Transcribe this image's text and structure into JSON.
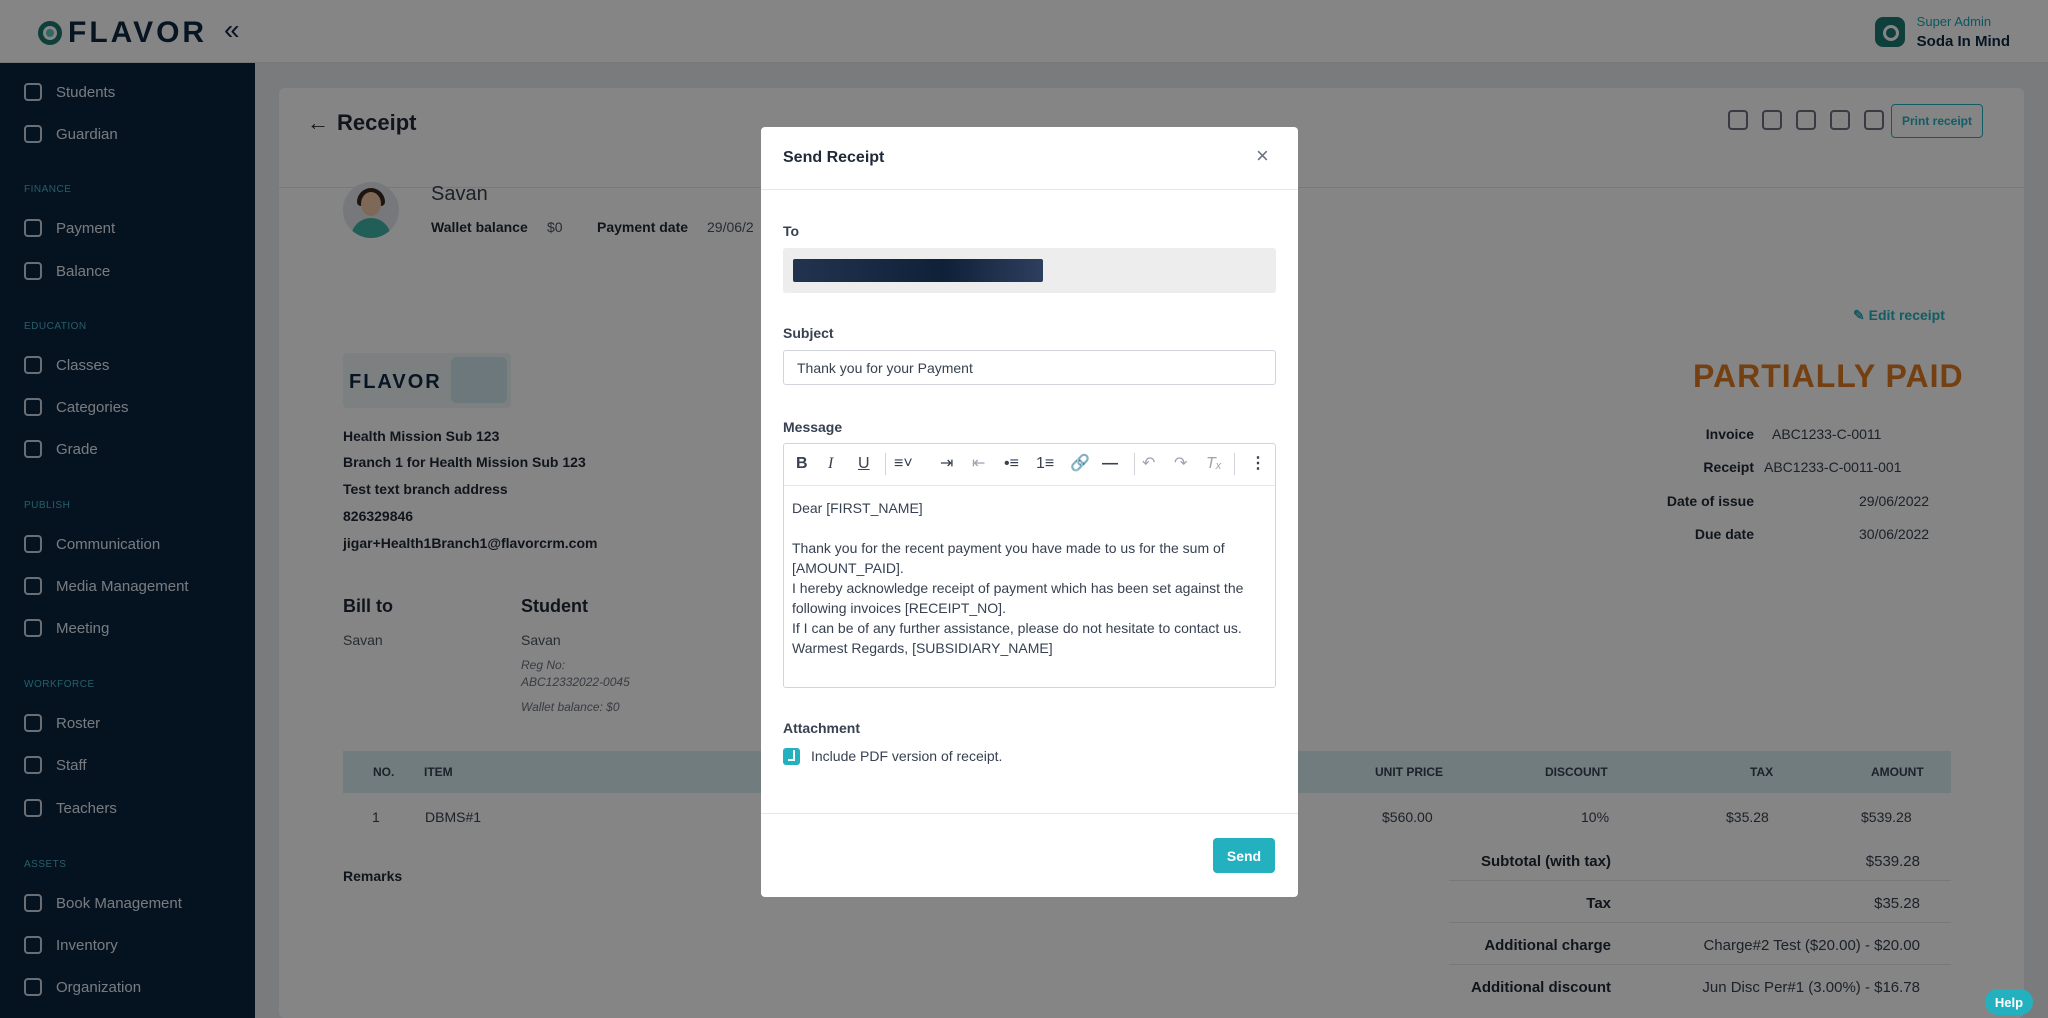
{
  "app": {
    "logo_text": "FLAVOR",
    "collapse_icon": "«"
  },
  "user": {
    "role": "Super Admin",
    "name": "Soda In Mind"
  },
  "sidebar": {
    "items": [
      {
        "label": "Students"
      },
      {
        "label": "Guardian"
      },
      {
        "section": "FINANCE"
      },
      {
        "label": "Payment"
      },
      {
        "label": "Balance"
      },
      {
        "section": "EDUCATION"
      },
      {
        "label": "Classes"
      },
      {
        "label": "Categories"
      },
      {
        "label": "Grade"
      },
      {
        "section": "PUBLISH"
      },
      {
        "label": "Communication"
      },
      {
        "label": "Media Management"
      },
      {
        "label": "Meeting"
      },
      {
        "section": "WORKFORCE"
      },
      {
        "label": "Roster"
      },
      {
        "label": "Staff"
      },
      {
        "label": "Teachers"
      },
      {
        "section": "ASSETS"
      },
      {
        "label": "Book Management"
      },
      {
        "label": "Inventory"
      },
      {
        "label": "Organization"
      }
    ]
  },
  "page": {
    "title": "Receipt",
    "print_label": "Print receipt",
    "edit_label": "Edit receipt",
    "status": "PARTIALLY PAID"
  },
  "student": {
    "name": "Savan",
    "wallet_label": "Wallet balance",
    "wallet_value": "$0",
    "payment_date_label": "Payment date",
    "payment_date_value": "29/06/2"
  },
  "receipt_info": {
    "invoice_label": "Invoice",
    "invoice_value": "ABC1233-C-0011",
    "receipt_label": "Receipt",
    "receipt_value": "ABC1233-C-0011-001",
    "issue_label": "Date of issue",
    "issue_value": "29/06/2022",
    "due_label": "Due date",
    "due_value": "30/06/2022"
  },
  "organization": {
    "logo_text": "FLAVOR",
    "lines": [
      "Health Mission Sub 123",
      "Branch 1 for Health Mission Sub 123",
      "Test text branch address",
      "826329846",
      "jigar+Health1Branch1@flavorcrm.com"
    ]
  },
  "bill_to": {
    "heading": "Bill to",
    "name": "Savan"
  },
  "student_block": {
    "heading": "Student",
    "name": "Savan",
    "reg_label": "Reg No:",
    "reg_value": "ABC12332022-0045",
    "wallet": "Wallet balance: $0"
  },
  "table": {
    "headers": [
      "NO.",
      "ITEM",
      "UNIT PRICE",
      "DISCOUNT",
      "TAX",
      "AMOUNT"
    ],
    "rows": [
      {
        "no": "1",
        "item": "DBMS#1",
        "unit_price": "$560.00",
        "discount": "10%",
        "tax": "$35.28",
        "amount": "$539.28"
      }
    ]
  },
  "remarks_label": "Remarks",
  "summary": [
    {
      "label": "Subtotal (with tax)",
      "value": "$539.28"
    },
    {
      "label": "Tax",
      "value": "$35.28"
    },
    {
      "label": "Additional charge",
      "value": "Charge#2 Test ($20.00) - $20.00"
    },
    {
      "label": "Additional discount",
      "value": "Jun Disc Per#1 (3.00%) - $16.78"
    }
  ],
  "modal": {
    "title": "Send Receipt",
    "to_label": "To",
    "subject_label": "Subject",
    "subject_value": "Thank you for your Payment",
    "message_label": "Message",
    "message_lines": [
      "Dear [FIRST_NAME]",
      "",
      "Thank you for the recent payment you have made to us for the sum of [AMOUNT_PAID].",
      "I hereby acknowledge receipt of payment which has been set against the following invoices [RECEIPT_NO].",
      "If I can be of any further assistance, please do not hesitate to contact us.",
      "Warmest Regards, [SUBSIDIARY_NAME]"
    ],
    "attachment_label": "Attachment",
    "attachment_checked": true,
    "attachment_text": "Include PDF version of receipt.",
    "send_label": "Send",
    "toolbar_icons": [
      "bold-icon",
      "italic-icon",
      "underline-icon",
      "align-icon",
      "indent-icon",
      "outdent-icon",
      "bullet-list-icon",
      "numbered-list-icon",
      "link-icon",
      "horizontal-rule-icon",
      "undo-icon",
      "redo-icon",
      "clear-format-icon",
      "more-icon"
    ]
  },
  "help_label": "Help",
  "colors": {
    "accent": "#23b1c0",
    "sidebar": "#0a2540",
    "status": "#e07b22"
  }
}
